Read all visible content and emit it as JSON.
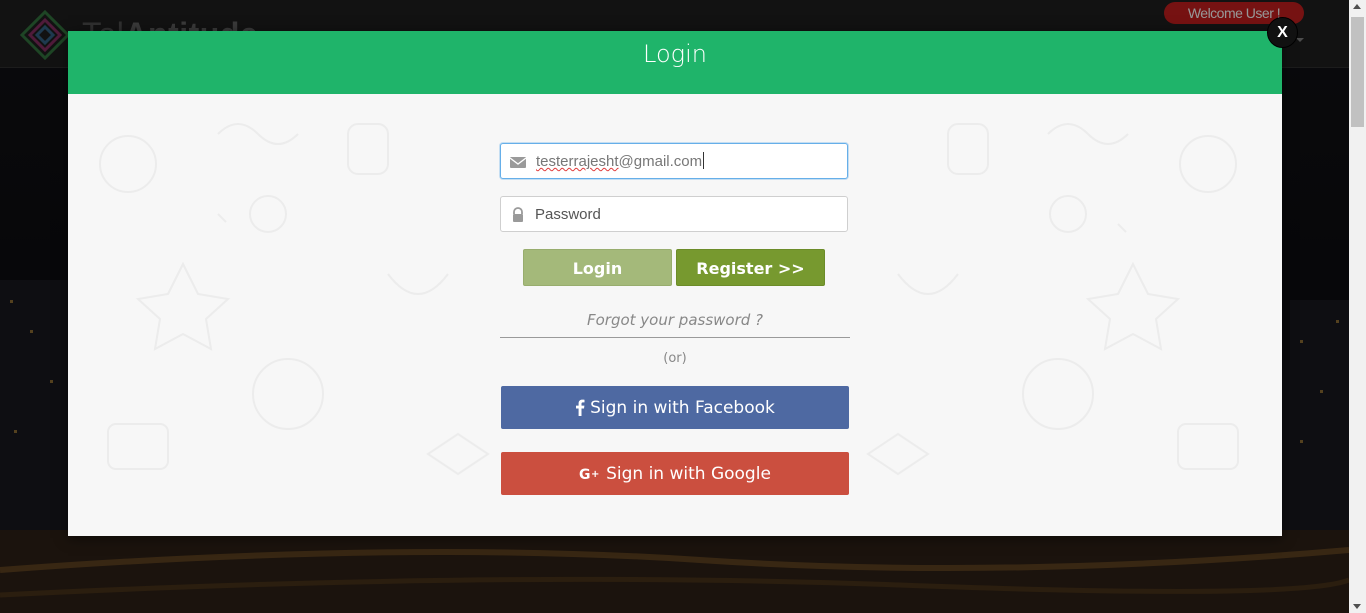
{
  "background": {
    "brand": {
      "prefix": "Tal",
      "suffix": "Antitude"
    },
    "welcome_text": "Welcome User !"
  },
  "modal": {
    "title": "Login",
    "close_label": "X",
    "email": {
      "value_spellflagged": "testerrajesht",
      "value_rest": "@gmail.com",
      "icon": "envelope-icon"
    },
    "password": {
      "placeholder": "Password",
      "icon": "lock-icon"
    },
    "login_label": "Login",
    "register_label": "Register >>",
    "forgot_label": "Forgot your password ?",
    "or_label": "(or)",
    "facebook_label": "Sign in with Facebook",
    "google_label": "Sign in with Google"
  },
  "colors": {
    "header_green": "#1fb46a",
    "login_button": "#a4b97a",
    "register_button": "#77992f",
    "facebook": "#4e69a2",
    "google": "#cb4f3f",
    "welcome_pill": "#b51c1c"
  }
}
